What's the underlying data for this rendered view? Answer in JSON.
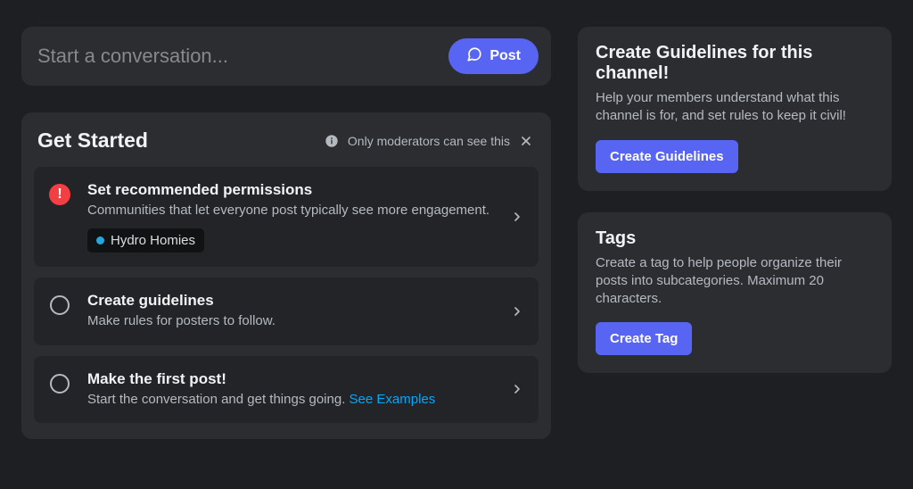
{
  "conversation": {
    "placeholder": "Start a conversation...",
    "post_label": "Post"
  },
  "get_started": {
    "title": "Get Started",
    "notice": "Only moderators can see this",
    "steps": [
      {
        "title": "Set recommended permissions",
        "desc": "Communities that let everyone post typically see more engagement.",
        "chip": "Hydro Homies"
      },
      {
        "title": "Create guidelines",
        "desc": "Make rules for posters to follow."
      },
      {
        "title": "Make the first post!",
        "desc_prefix": "Start the conversation and get things going. ",
        "link": "See Examples"
      }
    ]
  },
  "guidelines_panel": {
    "title": "Create Guidelines for this channel!",
    "desc": "Help your members understand what this channel is for, and set rules to keep it civil!",
    "button": "Create Guidelines"
  },
  "tags_panel": {
    "title": "Tags",
    "desc": "Create a tag to help people organize their posts into subcategories. Maximum 20 characters.",
    "button": "Create Tag"
  }
}
